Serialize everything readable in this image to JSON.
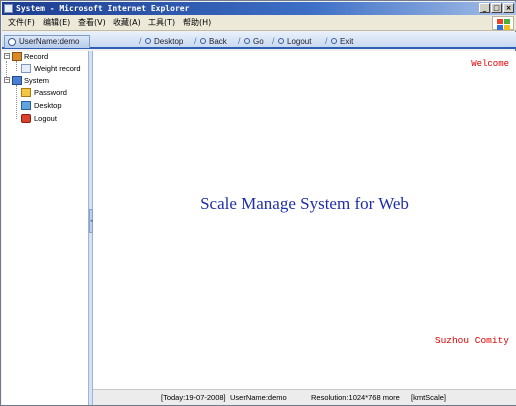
{
  "window": {
    "title": "System - Microsoft Internet Explorer",
    "buttons": {
      "minimize": "_",
      "maximize": "□",
      "close": "×"
    }
  },
  "menubar": {
    "items": [
      "文件(F)",
      "编辑(E)",
      "查看(V)",
      "收藏(A)",
      "工具(T)",
      "帮助(H)"
    ]
  },
  "navbar": {
    "user_label": "UserName:demo",
    "buttons": [
      "Desktop",
      "Back",
      "Go",
      "Logout",
      "Exit"
    ]
  },
  "tree": {
    "record": {
      "label": "Record",
      "children": [
        "Weight record"
      ]
    },
    "system": {
      "label": "System",
      "children": [
        "Password",
        "Desktop",
        "Logout"
      ]
    }
  },
  "content": {
    "welcome": "Welcome",
    "title": "Scale Manage System for Web",
    "company": "Suzhou Comity"
  },
  "statusbar": {
    "today": "[Today:19-07-2008]",
    "user": "UserName:demo",
    "resolution": "Resolution:1024*768 more",
    "brand": "[kmtScale]"
  },
  "colors": {
    "accent_blue": "#2f5fb4",
    "title_blue": "#1e2ea8",
    "red_text": "#e00000"
  }
}
